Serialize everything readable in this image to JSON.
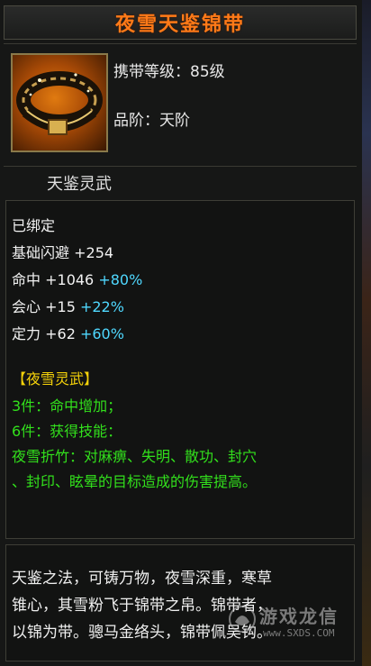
{
  "item": {
    "name": "夜雪天鉴锦带",
    "level_line": "携带等级：85级",
    "grade_line": "品阶：天阶",
    "subtitle": "天鉴灵武",
    "icon": "belt-icon"
  },
  "attributes": {
    "bound": "已绑定",
    "dodge": {
      "label": "基础闪避",
      "value": "+254"
    },
    "hit": {
      "label": "命中",
      "value": "+1046",
      "bonus": "+80%"
    },
    "crit": {
      "label": "会心",
      "value": "+15",
      "bonus": "+22%"
    },
    "willpower": {
      "label": "定力",
      "value": "+62",
      "bonus": "+60%"
    }
  },
  "set": {
    "name": "【夜雪灵武】",
    "bonus3": "3件：命中增加；",
    "bonus6": "6件：获得技能：",
    "skill_line1": "夜雪折竹：对麻痹、失明、散功、封穴",
    "skill_line2": "、封印、眩晕的目标造成的伤害提高。"
  },
  "description": {
    "line1": "天鉴之法，可铸万物，夜雪深重，寒草",
    "line2": "锥心，其雪粉飞于锦带之帛。锦带者，",
    "line3": "以锦为带。骢马金络头，锦带佩吴钩。"
  },
  "watermark": {
    "text": "游戏龙信",
    "url": "www.SXDS.COM"
  },
  "colors": {
    "title": "#ff7a18",
    "bonus": "#4fd8ff",
    "set_name": "#f5d20a",
    "set_text": "#32e01c"
  }
}
